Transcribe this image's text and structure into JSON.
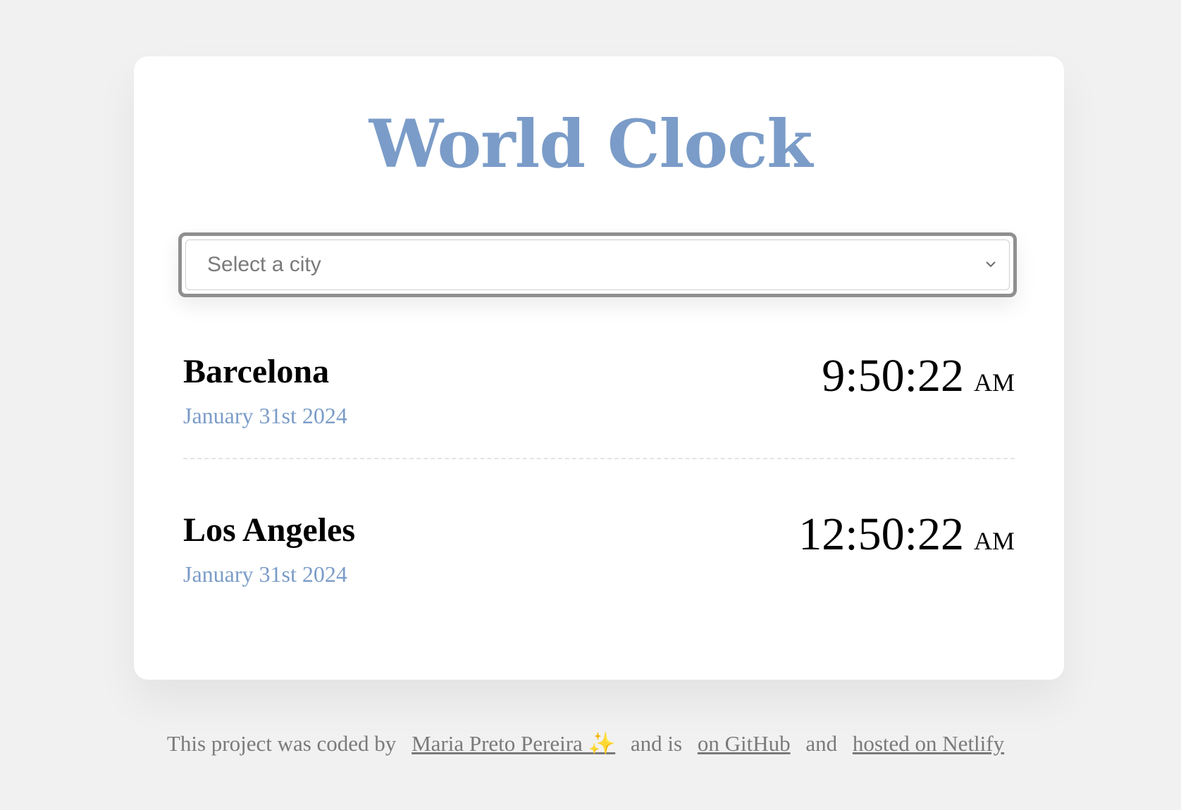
{
  "app": {
    "title": "World Clock"
  },
  "city_select": {
    "placeholder": "Select a city"
  },
  "cities": [
    {
      "name": "Barcelona",
      "date": "January 31st 2024",
      "time": "9:50:22",
      "ampm": "AM"
    },
    {
      "name": "Los Angeles",
      "date": "January 31st 2024",
      "time": "12:50:22",
      "ampm": "AM"
    }
  ],
  "footer": {
    "text_1": "This project was coded by",
    "author_link": "Maria Preto Pereira ✨",
    "text_2": "and is",
    "github_link": "on GitHub",
    "text_3": "and",
    "netlify_link": "hosted on Netlify"
  },
  "colors": {
    "accent": "#7b9cc8",
    "background": "#f1f1f1",
    "card": "#ffffff",
    "text": "#000000",
    "muted": "#7a7a7a"
  }
}
